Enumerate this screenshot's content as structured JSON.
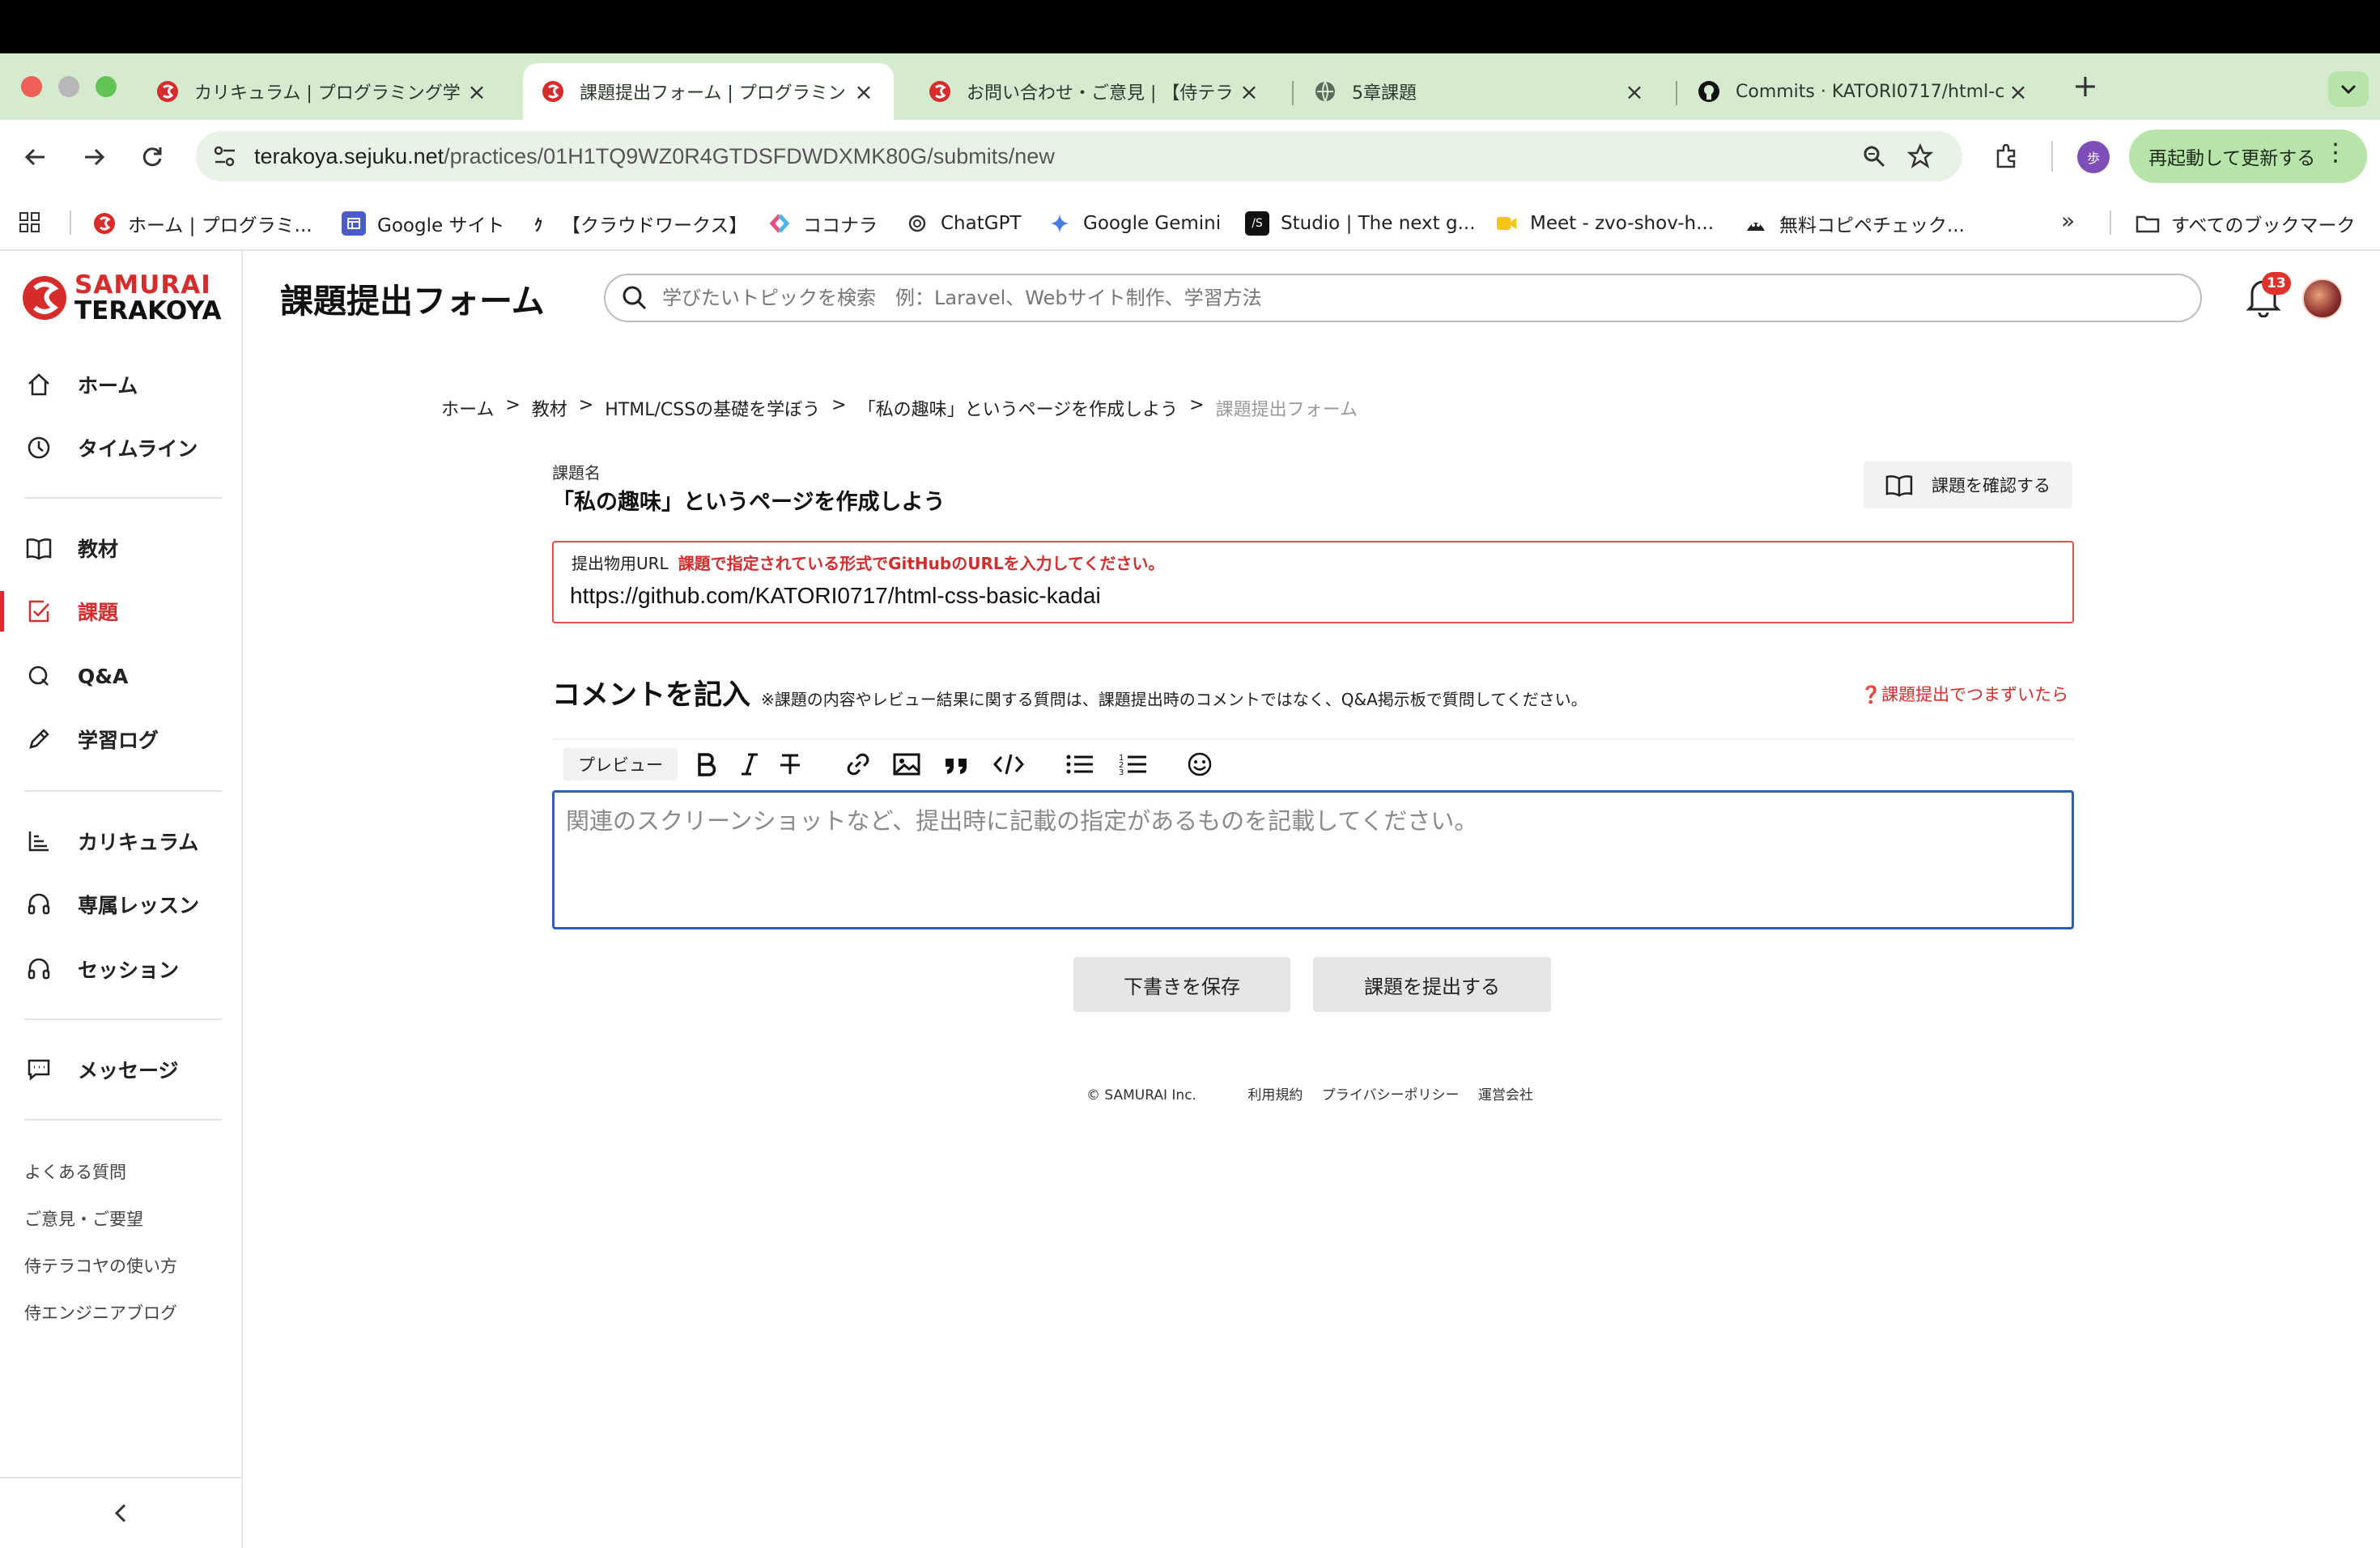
{
  "browser": {
    "tabs": [
      {
        "title": "カリキュラム | プログラミング学",
        "active": false
      },
      {
        "title": "課題提出フォーム | プログラミン",
        "active": true
      },
      {
        "title": "お問い合わせ・ご意見 | 【侍テラ",
        "active": false
      },
      {
        "title": "5章課題",
        "active": false
      },
      {
        "title": "Commits · KATORI0717/html-c",
        "active": false
      }
    ],
    "url_host": "terakoya.sejuku.net",
    "url_path": "/practices/01H1TQ9WZ0R4GTDSFDWDXMK80G/submits/new",
    "restart_label": "再起動して更新する",
    "profile_initial": "歩",
    "bookmarks": [
      "ホーム | プログラミ...",
      "Google サイト",
      "【クラウドワークス】",
      "ココナラ",
      "ChatGPT",
      "Google Gemini",
      "Studio | The next g...",
      "Meet - zvo-shov-h...",
      "無料コピペチェック..."
    ],
    "all_bookmarks": "すべてのブックマーク"
  },
  "brand": {
    "line1": "SAMURAI",
    "line2": "TERAKOYA",
    "color": "#d62c2c"
  },
  "sidebar": {
    "items": [
      {
        "label": "ホーム",
        "icon": "home-icon"
      },
      {
        "label": "タイムライン",
        "icon": "clock-icon"
      },
      {
        "label": "教材",
        "icon": "book-icon"
      },
      {
        "label": "課題",
        "icon": "task-icon",
        "active": true
      },
      {
        "label": "Q&A",
        "icon": "qa-icon"
      },
      {
        "label": "学習ログ",
        "icon": "pencil-icon"
      },
      {
        "label": "カリキュラム",
        "icon": "chart-icon"
      },
      {
        "label": "専属レッスン",
        "icon": "headset-icon"
      },
      {
        "label": "セッション",
        "icon": "headset-icon"
      },
      {
        "label": "メッセージ",
        "icon": "message-icon"
      }
    ],
    "links": [
      "よくある質問",
      "ご意見・ご要望",
      "侍テラコヤの使い方",
      "侍エンジニアブログ"
    ]
  },
  "header": {
    "title": "課題提出フォーム",
    "search_placeholder": "学びたいトピックを検索　例：Laravel、Webサイト制作、学習方法",
    "notification_count": "13"
  },
  "breadcrumb": [
    "ホーム",
    "教材",
    "HTML/CSSの基礎を学ぼう",
    "「私の趣味」というページを作成しよう",
    "課題提出フォーム"
  ],
  "task": {
    "label": "課題名",
    "name": "「私の趣味」というページを作成しよう",
    "check_button": "課題を確認する"
  },
  "url_field": {
    "label": "提出物用URL",
    "error": "課題で指定されている形式でGitHubのURLを入力してください。",
    "value": "https://github.com/KATORI0717/html-css-basic-kadai"
  },
  "comment": {
    "title": "コメントを記入",
    "note": "※課題の内容やレビュー結果に関する質問は、課題提出時のコメントではなく、Q&A掲示板で質問してください。",
    "help_link": "❓課題提出でつまずいたら",
    "preview_label": "プレビュー",
    "placeholder": "関連のスクリーンショットなど、提出時に記載の指定があるものを記載してください。"
  },
  "actions": {
    "save_draft": "下書きを保存",
    "submit": "課題を提出する"
  },
  "footer": {
    "copyright": "© SAMURAI Inc.",
    "links": [
      "利用規約",
      "プライバシーポリシー",
      "運営会社"
    ]
  }
}
